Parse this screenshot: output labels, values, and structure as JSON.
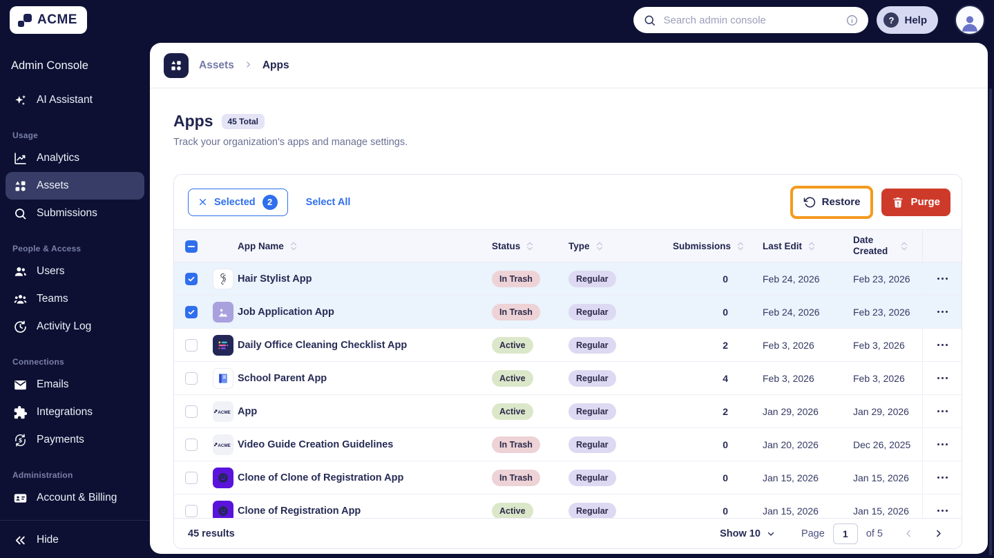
{
  "topbar": {
    "brand": "ACME",
    "search": {
      "placeholder": "Search admin console"
    },
    "help_label": "Help"
  },
  "sidebar": {
    "title": "Admin Console",
    "assistant_label": "AI Assistant",
    "sections": [
      {
        "label": "Usage",
        "items": [
          {
            "label": "Analytics",
            "icon": "analytics-icon",
            "active": false
          },
          {
            "label": "Assets",
            "icon": "assets-icon",
            "active": true
          },
          {
            "label": "Submissions",
            "icon": "search-icon",
            "active": false
          }
        ]
      },
      {
        "label": "People & Access",
        "items": [
          {
            "label": "Users",
            "icon": "users-icon",
            "active": false
          },
          {
            "label": "Teams",
            "icon": "teams-icon",
            "active": false
          },
          {
            "label": "Activity Log",
            "icon": "activity-log-icon",
            "active": false
          }
        ]
      },
      {
        "label": "Connections",
        "items": [
          {
            "label": "Emails",
            "icon": "email-icon",
            "active": false
          },
          {
            "label": "Integrations",
            "icon": "integrations-icon",
            "active": false
          },
          {
            "label": "Payments",
            "icon": "payments-icon",
            "active": false
          }
        ]
      },
      {
        "label": "Administration",
        "items": [
          {
            "label": "Account & Billing",
            "icon": "billing-icon",
            "active": false
          }
        ]
      }
    ],
    "hide_label": "Hide"
  },
  "breadcrumb": {
    "root": "Assets",
    "current": "Apps"
  },
  "page": {
    "title": "Apps",
    "total_badge": "45 Total",
    "subtitle": "Track your organization's apps and manage settings."
  },
  "toolbar": {
    "selected_label": "Selected",
    "selected_count": "2",
    "select_all_label": "Select All",
    "restore_label": "Restore",
    "purge_label": "Purge"
  },
  "table": {
    "columns": [
      "App Name",
      "Status",
      "Type",
      "Submissions",
      "Last Edit",
      "Date Created"
    ],
    "rows": [
      {
        "name": "Hair Stylist App",
        "icon": "hair-app-icon",
        "status": "In Trash",
        "type": "Regular",
        "submissions": "0",
        "last_edit": "Feb 24, 2026",
        "date_created": "Feb 23, 2026",
        "selected": true
      },
      {
        "name": "Job Application App",
        "icon": "photo-app-icon",
        "status": "In Trash",
        "type": "Regular",
        "submissions": "0",
        "last_edit": "Feb 24, 2026",
        "date_created": "Feb 23, 2026",
        "selected": true
      },
      {
        "name": "Daily Office Cleaning Checklist App",
        "icon": "checklist-app-icon",
        "status": "Active",
        "type": "Regular",
        "submissions": "2",
        "last_edit": "Feb 3, 2026",
        "date_created": "Feb 3, 2026",
        "selected": false
      },
      {
        "name": "School Parent App",
        "icon": "book-app-icon",
        "status": "Active",
        "type": "Regular",
        "submissions": "4",
        "last_edit": "Feb 3, 2026",
        "date_created": "Feb 3, 2026",
        "selected": false
      },
      {
        "name": "App",
        "icon": "acme-app-icon",
        "status": "Active",
        "type": "Regular",
        "submissions": "2",
        "last_edit": "Jan 29, 2026",
        "date_created": "Jan 29, 2026",
        "selected": false
      },
      {
        "name": "Video Guide Creation Guidelines",
        "icon": "acme-app-icon",
        "status": "In Trash",
        "type": "Regular",
        "submissions": "0",
        "last_edit": "Jan 20, 2026",
        "date_created": "Dec 26, 2025",
        "selected": false
      },
      {
        "name": "Clone of Clone of Registration App",
        "icon": "smiley-app-icon",
        "status": "In Trash",
        "type": "Regular",
        "submissions": "0",
        "last_edit": "Jan 15, 2026",
        "date_created": "Jan 15, 2026",
        "selected": false
      },
      {
        "name": "Clone of Registration App",
        "icon": "smiley-app-icon",
        "status": "Active",
        "type": "Regular",
        "submissions": "0",
        "last_edit": "Jan 15, 2026",
        "date_created": "Jan 15, 2026",
        "selected": false
      }
    ]
  },
  "footer": {
    "results": "45 results",
    "show_label": "Show 10",
    "page_label": "Page",
    "page_value": "1",
    "of_label": "of 5"
  },
  "colors": {
    "accent_blue": "#2F6FED",
    "purge_red": "#CE3A2A",
    "highlight_orange": "#F49A1D",
    "status_in_trash_bg": "#EDD2D6",
    "status_active_bg": "#DBE7C9",
    "type_regular_bg": "#DED9F2",
    "background_navy": "#0D1033"
  }
}
